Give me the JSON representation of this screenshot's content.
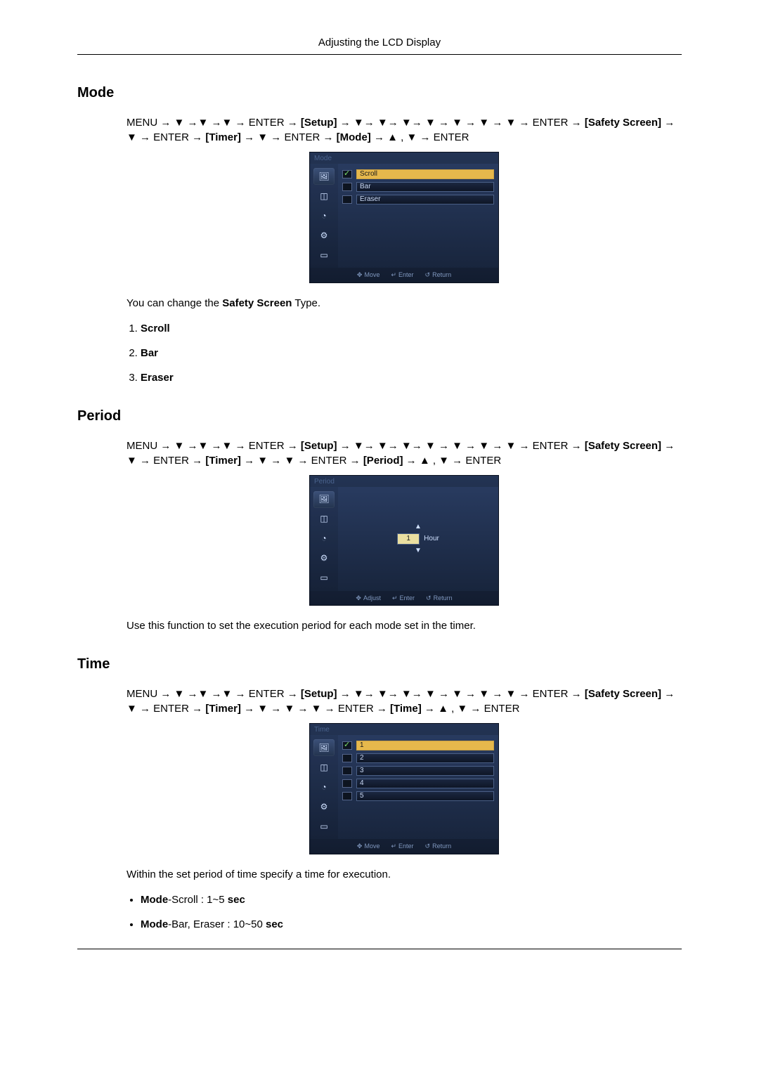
{
  "header": {
    "title": "Adjusting the LCD Display"
  },
  "mode": {
    "heading": "Mode",
    "nav": {
      "pre_setup": "MENU → ▼ →▼ →▼ → ENTER → ",
      "setup_b": "[Setup]",
      "post_setup": " → ▼→ ▼→ ▼→ ▼ → ▼ → ▼ → ▼ → ENTER → ",
      "safety_b": "[Safety Screen]",
      "post_safety": " → ▼ → ENTER → ",
      "timer_b": "[Timer]",
      "post_timer": " → ▼ → ENTER → ",
      "mode_b": "[Mode]",
      "tail": " → ▲ , ▼ → ENTER"
    },
    "osd": {
      "title": "Mode",
      "options": [
        {
          "label": "Scroll",
          "selected": true
        },
        {
          "label": "Bar",
          "selected": false
        },
        {
          "label": "Eraser",
          "selected": false
        }
      ],
      "footer": {
        "move": "Move",
        "enter": "Enter",
        "return": "Return"
      }
    },
    "description": {
      "pre": "You can change the ",
      "bold": "Safety Screen",
      "post": " Type."
    },
    "list": [
      "Scroll",
      "Bar",
      "Eraser"
    ]
  },
  "period": {
    "heading": "Period",
    "nav": {
      "pre_setup": "MENU → ▼ →▼ →▼ → ENTER → ",
      "setup_b": "[Setup]",
      "post_setup": " → ▼→ ▼→ ▼→ ▼ → ▼ → ▼ → ▼ → ENTER → ",
      "safety_b": "[Safety Screen]",
      "post_safety": " → ▼ → ENTER → ",
      "timer_b": "[Timer]",
      "post_timer": " → ▼ → ▼ → ENTER → ",
      "period_b": "[Period]",
      "tail": " → ▲ , ▼ → ENTER"
    },
    "osd": {
      "title": "Period",
      "value": "1",
      "unit": "Hour",
      "footer": {
        "adjust": "Adjust",
        "enter": "Enter",
        "return": "Return"
      }
    },
    "description": "Use this function to set the execution period for each mode set in the timer."
  },
  "time": {
    "heading": "Time",
    "nav": {
      "pre_setup": "MENU → ▼ →▼ →▼ → ENTER → ",
      "setup_b": "[Setup]",
      "post_setup": " → ▼→ ▼→ ▼→ ▼ → ▼ → ▼ → ▼ → ENTER → ",
      "safety_b": "[Safety Screen]",
      "post_safety": " → ▼ → ENTER → ",
      "timer_b": "[Timer]",
      "post_timer": " → ▼ → ▼ → ▼ → ENTER → ",
      "time_b": "[Time]",
      "tail": " → ▲ , ▼ → ENTER"
    },
    "osd": {
      "title": "Time",
      "options": [
        {
          "label": "1",
          "selected": true
        },
        {
          "label": "2",
          "selected": false
        },
        {
          "label": "3",
          "selected": false
        },
        {
          "label": "4",
          "selected": false
        },
        {
          "label": "5",
          "selected": false
        }
      ],
      "footer": {
        "move": "Move",
        "enter": "Enter",
        "return": "Return"
      }
    },
    "description": "Within the set period of time specify a time for execution.",
    "bullets": [
      {
        "bold": "Mode",
        "text": "-Scroll : 1~5 ",
        "bold2": "sec"
      },
      {
        "bold": "Mode",
        "text": "-Bar, Eraser : 10~50 ",
        "bold2": "sec"
      }
    ]
  },
  "sidebar_icons": [
    "icon-picture",
    "icon-pip",
    "icon-timer",
    "icon-gear",
    "icon-display"
  ]
}
